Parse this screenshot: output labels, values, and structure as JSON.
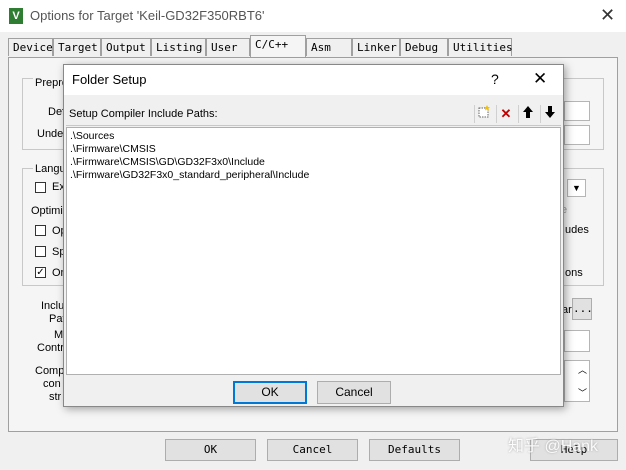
{
  "window": {
    "title": "Options for Target 'Keil-GD32F350RBT6'",
    "close_glyph": "✕",
    "icon_glyph": "V"
  },
  "tabs": [
    "Device",
    "Target",
    "Output",
    "Listing",
    "User",
    "C/C++",
    "Asm",
    "Linker",
    "Debug",
    "Utilities"
  ],
  "active_tab": "C/C++",
  "background_labels": {
    "prepro": "Prepro",
    "def": "Def",
    "undef": "Undef",
    "langu": "Langu",
    "ex": "Ex",
    "optimiz": "Optimiz",
    "op": "Op",
    "sp": "Sp",
    "on": "On",
    "udes": "udes",
    "ons": "ons",
    "inclu": "Inclu",
    "pat": "Pat",
    "m": "M",
    "contr": "Contr",
    "comp": "Comp",
    "con": "con",
    "str": "str",
    "ellipsis": "...",
    "ar": "ar",
    "e": "e"
  },
  "footer_buttons": {
    "ok": "OK",
    "cancel": "Cancel",
    "defaults": "Defaults",
    "help": "Help"
  },
  "watermark": "知乎 @Hank",
  "dialog": {
    "title": "Folder Setup",
    "help_glyph": "?",
    "close_glyph": "✕",
    "list_label": "Setup Compiler Include Paths:",
    "toolbar": {
      "new_icon": "new-folder-icon",
      "delete_glyph": "✕",
      "up_glyph": "🡑",
      "down_glyph": "🡓"
    },
    "paths": [
      ".\\Sources",
      ".\\Firmware\\CMSIS",
      ".\\Firmware\\CMSIS\\GD\\GD32F3x0\\Include",
      ".\\Firmware\\GD32F3x0_standard_peripheral\\Include"
    ],
    "ok_label": "OK",
    "cancel_label": "Cancel"
  },
  "colors": {
    "accent": "#0078d7",
    "delete": "#c00000"
  }
}
